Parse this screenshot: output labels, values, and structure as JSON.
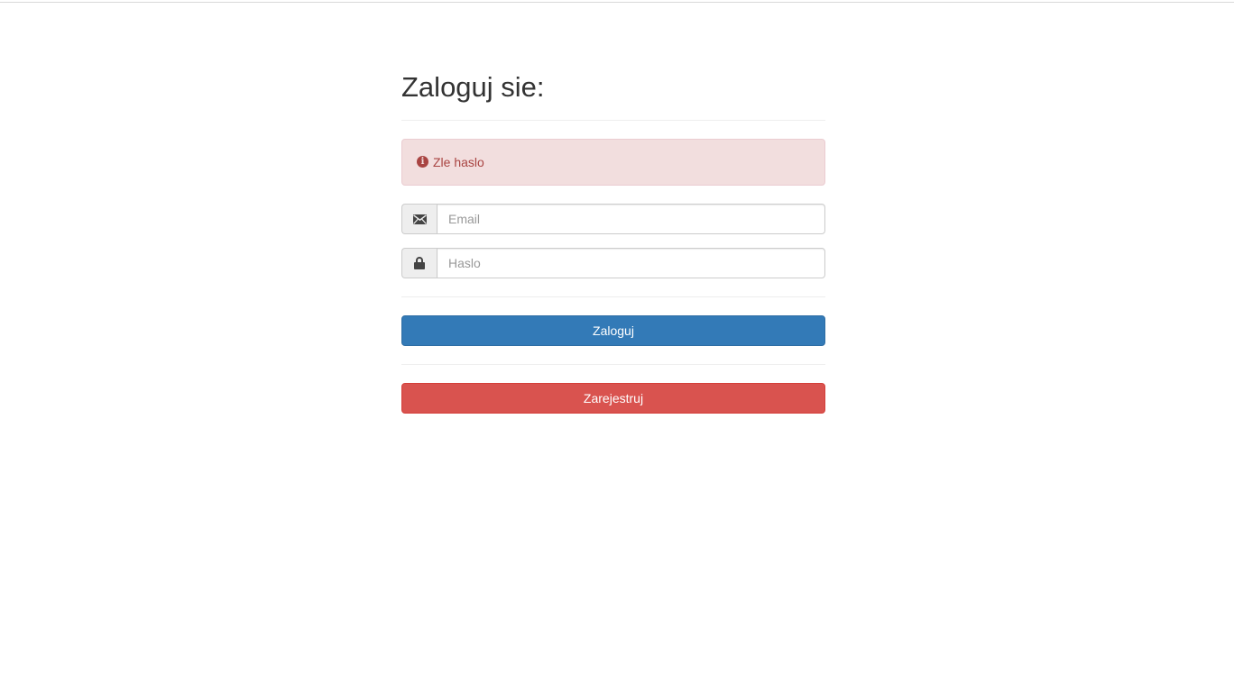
{
  "login": {
    "title": "Zaloguj sie:",
    "alert": {
      "icon": "info-circle-icon",
      "message": "Zle haslo",
      "color": "#a94442",
      "background": "#f2dede"
    },
    "email": {
      "icon": "envelope-icon",
      "placeholder": "Email",
      "value": ""
    },
    "password": {
      "icon": "lock-icon",
      "placeholder": "Haslo",
      "value": ""
    },
    "submit_label": "Zaloguj",
    "register_label": "Zarejestruj"
  },
  "colors": {
    "primary": "#337ab7",
    "danger": "#d9534f"
  }
}
